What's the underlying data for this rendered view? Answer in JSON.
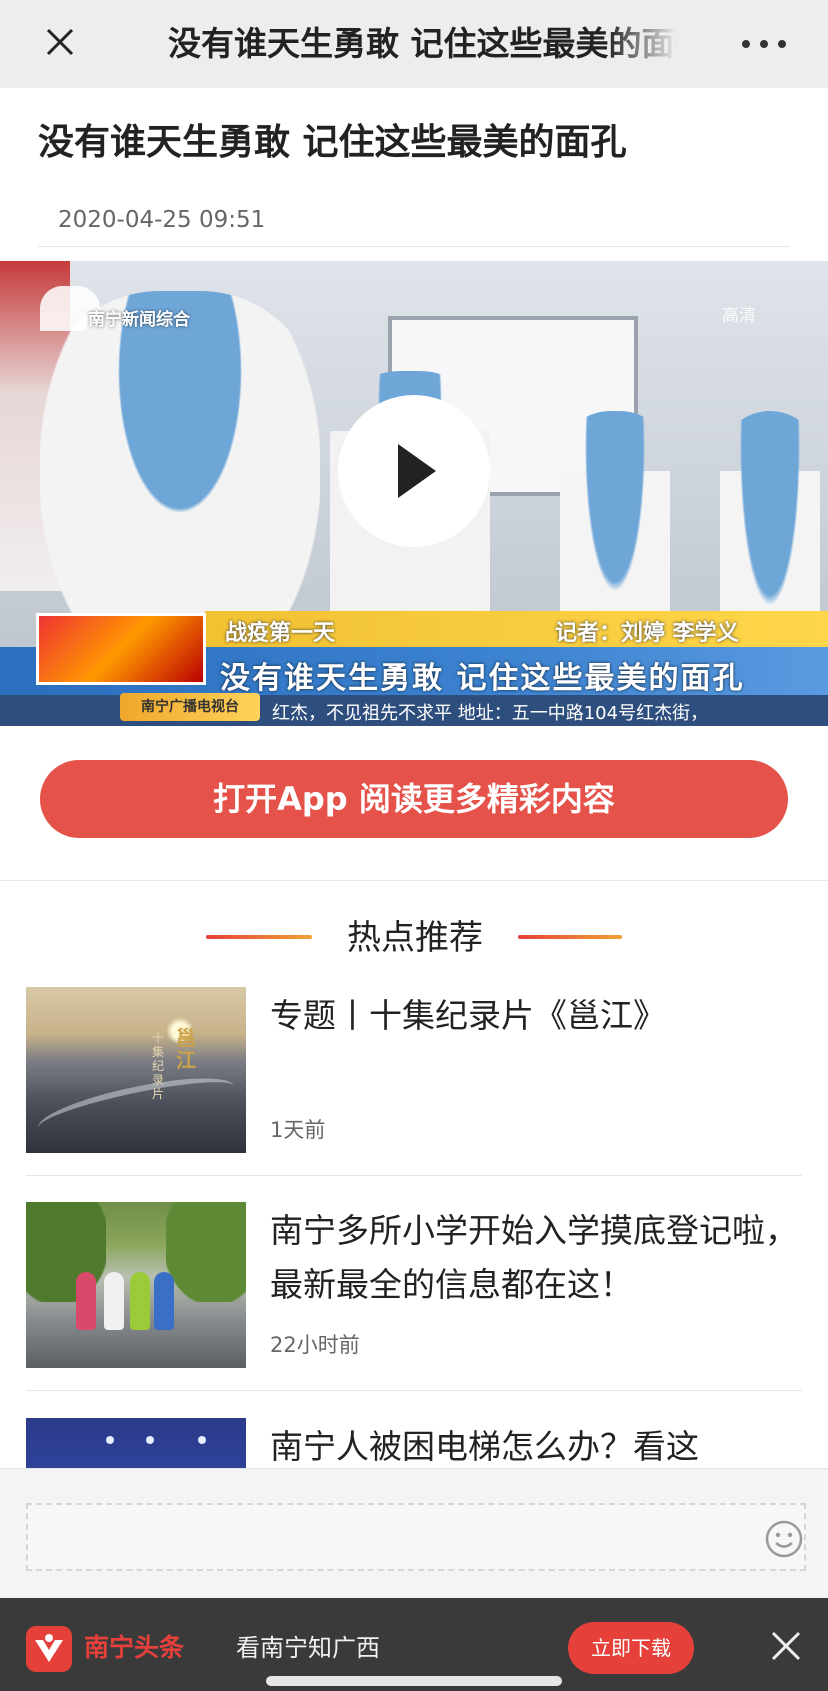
{
  "nav": {
    "title": "没有谁天生勇敢 记住这些最美的面孔"
  },
  "article": {
    "title": "没有谁天生勇敢 记住这些最美的面孔",
    "date": "2020-04-25 09:51"
  },
  "video": {
    "channel": "南宁新闻综合",
    "quality": "高清",
    "band_left": "战疫第一天",
    "band_right": "记者：刘婷  李学义",
    "caption": "没有谁天生勇敢  记住这些最美的面孔",
    "ticker": "红杰，不见祖先不求平 地址：五一中路104号红杰街，",
    "station": "南宁广播电视台"
  },
  "cta": {
    "label": "打开App 阅读更多精彩内容"
  },
  "recommend": {
    "heading": "热点推荐",
    "items": [
      {
        "headline": "专题丨十集纪录片《邕江》",
        "time": "1天前"
      },
      {
        "headline": "南宁多所小学开始入学摸底登记啦，最新最全的信息都在这！",
        "time": "22小时前"
      },
      {
        "headline": "南宁人被困电梯怎么办？看这",
        "time": ""
      }
    ],
    "thumb_text": {
      "title": "邕江",
      "sub": "十集纪录片"
    }
  },
  "banner": {
    "app_name": "南宁头条",
    "slogan": "看南宁知广西",
    "download": "立即下载"
  },
  "colors": {
    "accent": "#e5403a",
    "cta": "#e5524a",
    "nav_bg": "#ededed",
    "banner_bg": "#3a3a3a"
  }
}
